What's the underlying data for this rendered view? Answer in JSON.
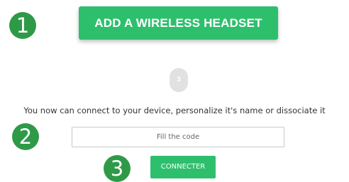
{
  "markers": {
    "one": "1",
    "two": "2",
    "three": "3"
  },
  "add_headset_button": {
    "label": "ADD A WIRELESS HEADSET"
  },
  "step_indicator": {
    "number": "3"
  },
  "instruction": "You now can connect to your device, personalize it's name or dissociate it",
  "code_input": {
    "placeholder": "Fill the code",
    "value": ""
  },
  "connect_button": {
    "label": "CONNECTER"
  },
  "colors": {
    "accent_green": "#2ebf6d",
    "marker_green": "#2e9a48",
    "step_grey": "#e1e1e1"
  }
}
